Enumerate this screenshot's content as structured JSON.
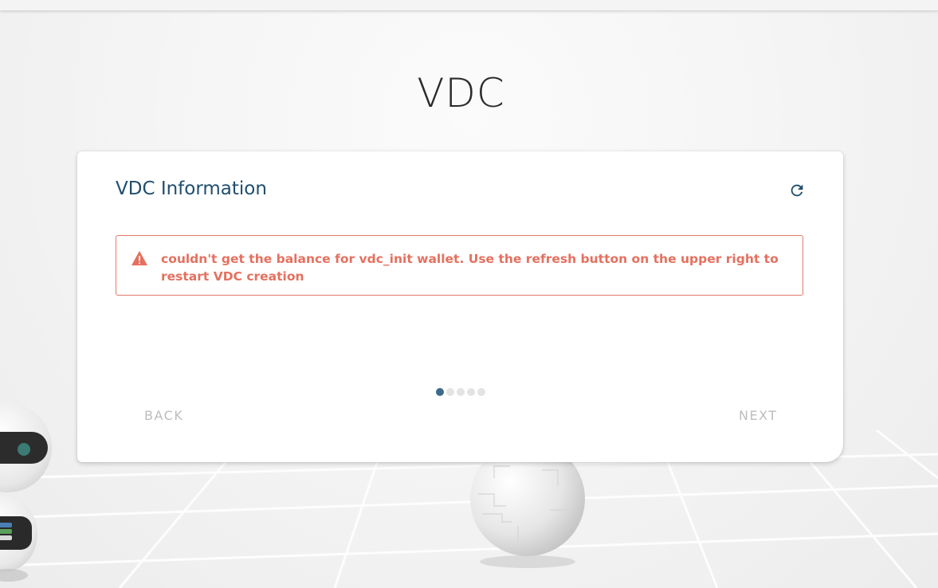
{
  "page": {
    "title": "VDC"
  },
  "card": {
    "title": "VDC Information",
    "refresh_icon": "refresh-icon",
    "alert": {
      "icon": "warning-icon",
      "message": "couldn't get the balance for vdc_init wallet. Use the refresh button on the upper right to restart VDC creation",
      "color": "#e5705f"
    },
    "stepper": {
      "total_steps": 5,
      "current_step": 1
    },
    "back_label": "BACK",
    "next_label": "NEXT"
  },
  "colors": {
    "title_blue": "#1f4e6e",
    "step_active": "#3d6a89",
    "step_inactive": "#e3e3e3",
    "disabled_text": "#bdbdbd"
  }
}
